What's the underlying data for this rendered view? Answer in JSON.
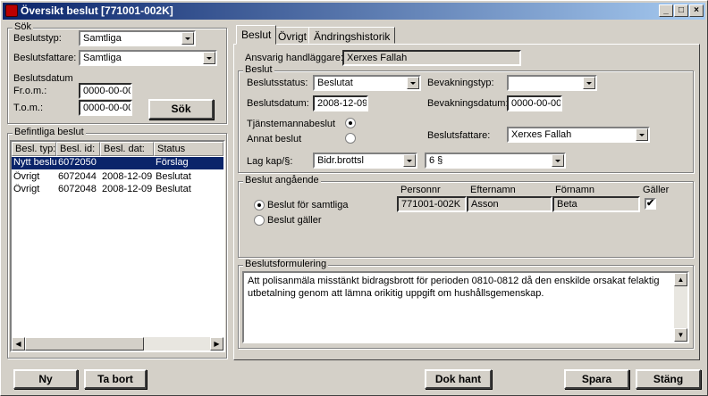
{
  "window": {
    "title": "Översikt beslut  [771001-002K]",
    "controls": {
      "minimize": "_",
      "maximize": "□",
      "close": "×"
    }
  },
  "search": {
    "group_label": "Sök",
    "beslutstyp_label": "Beslutstyp:",
    "beslutstyp_value": "Samtliga",
    "beslutsfattare_label": "Beslutsfattare:",
    "beslutsfattare_value": "Samtliga",
    "beslutsdatum_label": "Beslutsdatum",
    "from_label": "Fr.o.m.:",
    "from_value": "0000-00-00",
    "to_label": "T.o.m.:",
    "to_value": "0000-00-00",
    "search_button": "Sök"
  },
  "existing": {
    "group_label": "Befintliga beslut",
    "columns": [
      "Besl. typ:",
      "Besl. id:",
      "Besl. dat:",
      "Status"
    ],
    "rows": [
      {
        "typ": "Nytt beslu",
        "id": "6072050",
        "dat": "",
        "status": "Förslag",
        "selected": true
      },
      {
        "typ": "Övrigt",
        "id": "6072044",
        "dat": "2008-12-09",
        "status": "Beslutat",
        "selected": false
      },
      {
        "typ": "Övrigt",
        "id": "6072048",
        "dat": "2008-12-09",
        "status": "Beslutat",
        "selected": false
      }
    ]
  },
  "tabs": [
    {
      "label": "Beslut",
      "active": true
    },
    {
      "label": "Övrigt",
      "active": false
    },
    {
      "label": "Ändringshistorik",
      "active": false
    }
  ],
  "detail": {
    "ansvarig_label": "Ansvarig handläggare:",
    "ansvarig_value": "Xerxes Fallah",
    "beslut_group": "Beslut",
    "beslutsstatus_label": "Beslutsstatus:",
    "beslutsstatus_value": "Beslutat",
    "bevakningstyp_label": "Bevakningstyp:",
    "bevakningstyp_value": "",
    "beslutsdatum_label": "Beslutsdatum:",
    "beslutsdatum_value": "2008-12-09",
    "bevakningsdatum_label": "Bevakningsdatum:",
    "bevakningsdatum_value": "0000-00-00",
    "tjanstemannabeslut_label": "Tjänstemannabeslut",
    "annat_beslut_label": "Annat beslut",
    "beslutsfattare_label": "Beslutsfattare:",
    "beslutsfattare_value": "Xerxes Fallah",
    "lag_label": "Lag kap/§:",
    "lag_value": "Bidr.brottsl",
    "paragraf_value": "6 §"
  },
  "angaende": {
    "group_label": "Beslut angående",
    "option_all": "Beslut för samtliga",
    "option_galler": "Beslut gäller",
    "columns": [
      "Personnr",
      "Efternamn",
      "Förnamn",
      "Gäller"
    ],
    "person": {
      "personnr": "771001-002K",
      "efternamn": "Asson",
      "fornamn": "Beta",
      "galler": "✔"
    }
  },
  "formulering": {
    "group_label": "Beslutsformulering",
    "text": "Att polisanmäla misstänkt bidragsbrott för perioden 0810-0812 då den enskilde orsakat felaktig utbetalning genom att lämna orikitig uppgift om hushållsgemenskap."
  },
  "buttons": {
    "ny": "Ny",
    "ta_bort": "Ta bort",
    "dok_hant": "Dok hant",
    "spara": "Spara",
    "stang": "Stäng"
  }
}
